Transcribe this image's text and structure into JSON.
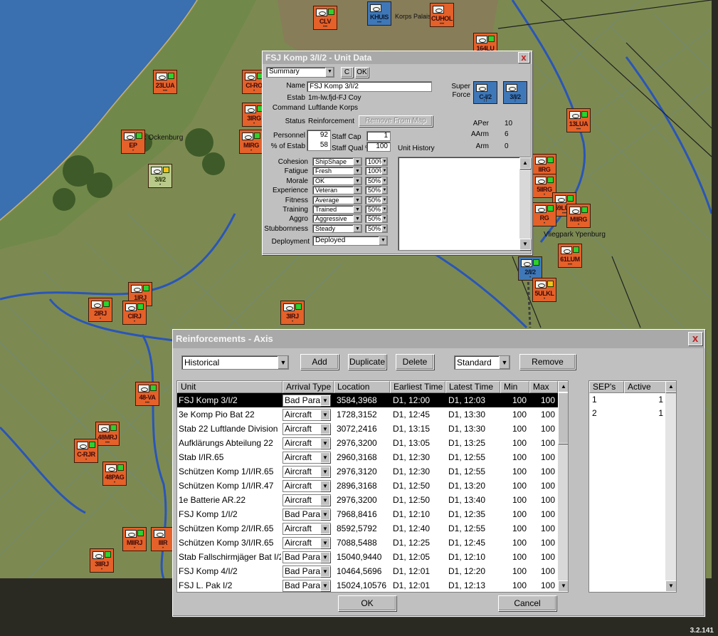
{
  "map": {
    "places": [
      "Park Ockenburg",
      "Vliegpark Ypenburg",
      "Korps Palais"
    ],
    "counters": [
      {
        "label": "CLV",
        "color": "red"
      },
      {
        "label": "KHUIS",
        "color": "blue"
      },
      {
        "label": "CUHOL",
        "color": "red"
      },
      {
        "label": "164LU",
        "color": "red"
      },
      {
        "label": "23LUA",
        "color": "red"
      },
      {
        "label": "CI-RO",
        "color": "red"
      },
      {
        "label": "3IRG",
        "color": "red"
      },
      {
        "label": "MIRG",
        "color": "red"
      },
      {
        "label": "EP",
        "color": "red"
      },
      {
        "label": "3/I/2",
        "color": "green"
      },
      {
        "label": "13LUA",
        "color": "red"
      },
      {
        "label": "IIRG",
        "color": "red"
      },
      {
        "label": "5IIRG",
        "color": "red"
      },
      {
        "label": "59LUM",
        "color": "red"
      },
      {
        "label": "MIIRG",
        "color": "red"
      },
      {
        "label": "RG",
        "color": "red"
      },
      {
        "label": "61LUM",
        "color": "red"
      },
      {
        "label": "2/I/2",
        "color": "blue"
      },
      {
        "label": "5ULKL",
        "color": "red"
      },
      {
        "label": "1IRJ",
        "color": "red"
      },
      {
        "label": "2IRJ",
        "color": "red"
      },
      {
        "label": "CIRJ",
        "color": "red"
      },
      {
        "label": "3IRJ",
        "color": "red"
      },
      {
        "label": "48-VA",
        "color": "red"
      },
      {
        "label": "48MRJ",
        "color": "red"
      },
      {
        "label": "C-RJR",
        "color": "red"
      },
      {
        "label": "48PAG",
        "color": "red"
      },
      {
        "label": "MIIRJ",
        "color": "red"
      },
      {
        "label": "IIIR",
        "color": "red"
      },
      {
        "label": "3IIRJ",
        "color": "red"
      }
    ]
  },
  "unit_data": {
    "title": "FSJ Komp 3/I/2 - Unit Data",
    "close_label": "x",
    "view_select": "Summary",
    "c_label": "C",
    "ok_label": "OK",
    "name_label": "Name",
    "name_value": "FSJ Komp 3/I/2",
    "estab_label": "Estab",
    "estab_value": "1m-lw.fjd-FJ Coy",
    "command_label": "Command",
    "command_value": "Luftlande Korps",
    "status_label": "Status",
    "status_value": "Reinforcement",
    "remove_from_map_label": "Remove From Map",
    "super_force_label": "Super Force",
    "super_force_units": [
      "C-I/2",
      "3/I/2"
    ],
    "personnel_label": "Personnel",
    "personnel_value": "92",
    "pct_estab_label": "% of Estab",
    "pct_estab_value": "58",
    "staff_cap_label": "Staff Cap",
    "staff_cap_value": "1",
    "staff_qual_label": "Staff Qual %",
    "staff_qual_value": "100",
    "unit_history_label": "Unit History",
    "aper_label": "APer",
    "aper_value": "10",
    "aarm_label": "AArm",
    "aarm_value": "6",
    "arm_label": "Arm",
    "arm_value": "0",
    "attributes": [
      {
        "label": "Cohesion",
        "value": "ShipShape",
        "pct": "100%"
      },
      {
        "label": "Fatigue",
        "value": "Fresh",
        "pct": "100%"
      },
      {
        "label": "Morale",
        "value": "OK",
        "pct": "50%"
      },
      {
        "label": "Experience",
        "value": "Veteran",
        "pct": "50%"
      },
      {
        "label": "Fitness",
        "value": "Average",
        "pct": "50%"
      },
      {
        "label": "Training",
        "value": "Trained",
        "pct": "50%"
      },
      {
        "label": "Aggro",
        "value": "Aggressive",
        "pct": "50%"
      },
      {
        "label": "Stubbornness",
        "value": "Steady",
        "pct": "50%"
      }
    ],
    "deployment_label": "Deployment",
    "deployment_value": "Deployed"
  },
  "reinforcements": {
    "title": "Reinforcements - Axis",
    "close_label": "x",
    "schedule_select": "Historical",
    "add_label": "Add",
    "duplicate_label": "Duplicate",
    "delete_label": "Delete",
    "mode_select": "Standard",
    "remove_label": "Remove",
    "columns": [
      "Unit",
      "Arrival Type",
      "Location",
      "Earliest Time",
      "Latest Time",
      "Min",
      "Max"
    ],
    "rows": [
      {
        "unit": "FSJ Komp 3/I/2",
        "arrival": "Bad Para",
        "location": "3584,3968",
        "earliest": "D1, 12:00",
        "latest": "D1, 12:03",
        "min": "100",
        "max": "100"
      },
      {
        "unit": "3e Komp Pio Bat 22",
        "arrival": "Aircraft",
        "location": "1728,3152",
        "earliest": "D1, 12:45",
        "latest": "D1, 13:30",
        "min": "100",
        "max": "100"
      },
      {
        "unit": "Stab 22 Luftlande Division",
        "arrival": "Aircraft",
        "location": "3072,2416",
        "earliest": "D1, 13:15",
        "latest": "D1, 13:30",
        "min": "100",
        "max": "100"
      },
      {
        "unit": "Aufklärungs Abteilung 22",
        "arrival": "Aircraft",
        "location": "2976,3200",
        "earliest": "D1, 13:05",
        "latest": "D1, 13:25",
        "min": "100",
        "max": "100"
      },
      {
        "unit": "Stab I/IR.65",
        "arrival": "Aircraft",
        "location": "2960,3168",
        "earliest": "D1, 12:30",
        "latest": "D1, 12:55",
        "min": "100",
        "max": "100"
      },
      {
        "unit": "Schützen Komp 1/I/IR.65",
        "arrival": "Aircraft",
        "location": "2976,3120",
        "earliest": "D1, 12:30",
        "latest": "D1, 12:55",
        "min": "100",
        "max": "100"
      },
      {
        "unit": "Schützen Komp 1/I/IR.47",
        "arrival": "Aircraft",
        "location": "2896,3168",
        "earliest": "D1, 12:50",
        "latest": "D1, 13:20",
        "min": "100",
        "max": "100"
      },
      {
        "unit": "1e Batterie AR.22",
        "arrival": "Aircraft",
        "location": "2976,3200",
        "earliest": "D1, 12:50",
        "latest": "D1, 13:40",
        "min": "100",
        "max": "100"
      },
      {
        "unit": "FSJ Komp 1/I/2",
        "arrival": "Bad Para",
        "location": "7968,8416",
        "earliest": "D1, 12:10",
        "latest": "D1, 12:35",
        "min": "100",
        "max": "100"
      },
      {
        "unit": "Schützen Komp 2/I/IR.65",
        "arrival": "Aircraft",
        "location": "8592,5792",
        "earliest": "D1, 12:40",
        "latest": "D1, 12:55",
        "min": "100",
        "max": "100"
      },
      {
        "unit": "Schützen Komp 3/I/IR.65",
        "arrival": "Aircraft",
        "location": "7088,5488",
        "earliest": "D1, 12:25",
        "latest": "D1, 12:45",
        "min": "100",
        "max": "100"
      },
      {
        "unit": "Stab Fallschirmjäger Bat I/2",
        "arrival": "Bad Para",
        "location": "15040,9440",
        "earliest": "D1, 12:05",
        "latest": "D1, 12:10",
        "min": "100",
        "max": "100"
      },
      {
        "unit": "FSJ Komp 4/I/2",
        "arrival": "Bad Para",
        "location": "10464,5696",
        "earliest": "D1, 12:01",
        "latest": "D1, 12:20",
        "min": "100",
        "max": "100"
      },
      {
        "unit": "FSJ L. Pak I/2",
        "arrival": "Bad Para",
        "location": "15024,10576",
        "earliest": "D1, 12:01",
        "latest": "D1, 12:13",
        "min": "100",
        "max": "100"
      }
    ],
    "sep_columns": [
      "SEP's",
      "Active"
    ],
    "sep_rows": [
      {
        "sep": "1",
        "active": "1"
      },
      {
        "sep": "2",
        "active": "1"
      }
    ],
    "ok_label": "OK",
    "cancel_label": "Cancel"
  },
  "version": "3.2.141"
}
